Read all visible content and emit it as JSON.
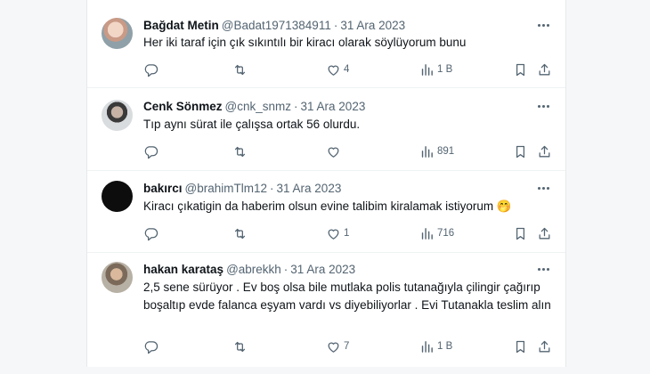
{
  "tweets": [
    {
      "name": "Bağdat Metin",
      "handle": "@Badat1971384911",
      "date": "31 Ara 2023",
      "text": "Her iki taraf için çık sıkıntılı bir kiracı olarak söylüyorum bunu",
      "text_lines": [],
      "likes": "4",
      "views": "1 B"
    },
    {
      "name": "Cenk Sönmez",
      "handle": "@cnk_snmz",
      "date": "31 Ara 2023",
      "text": "Tıp aynı sürat ile çalışsa ortak 56 olurdu.",
      "likes": "",
      "views": "891"
    },
    {
      "name": "bakırcı",
      "handle": "@brahimTlm12",
      "date": "31 Ara 2023",
      "text": "Kiracı çıkatigin da haberim olsun  evine talibim kiralamak istiyorum 🤭",
      "likes": "1",
      "views": "716"
    },
    {
      "name": "hakan karataş",
      "handle": "@abrekkh",
      "date": "31 Ara 2023",
      "text": "2,5 sene sürüyor . Ev boş olsa bile mutlaka polis tutanağıyla çilingir çağırıp boşaltıp evde falanca eşyam vardı vs diyebiliyorlar . Evi Tutanakla teslim alın",
      "likes": "7",
      "views": "1 B"
    }
  ],
  "separator": "·",
  "colors": {
    "text": "#0f1419",
    "secondary": "#536471",
    "divider": "#eff3f4"
  },
  "icons": [
    "reply-icon",
    "retweet-icon",
    "like-icon",
    "views-icon",
    "bookmark-icon",
    "share-icon",
    "more-icon"
  ]
}
